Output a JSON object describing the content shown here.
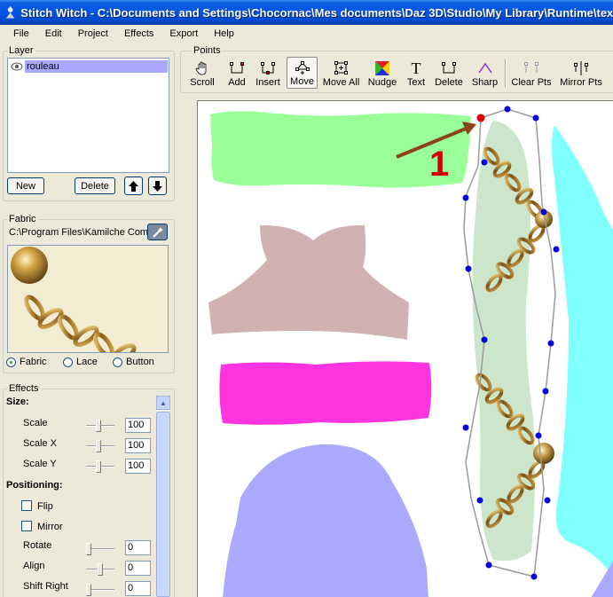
{
  "window": {
    "title": "Stitch Witch - C:\\Documents and Settings\\Chocornac\\Mes documents\\Daz 3D\\Studio\\My Library\\Runtime\\textures"
  },
  "menu": [
    "File",
    "Edit",
    "Project",
    "Effects",
    "Export",
    "Help"
  ],
  "layer_panel": {
    "title": "Layer",
    "layers": [
      {
        "name": "rouleau",
        "visible": true,
        "selected": true
      }
    ],
    "new_label": "New",
    "delete_label": "Delete"
  },
  "fabric_panel": {
    "title": "Fabric",
    "path": "C:\\Program Files\\Kamilche Company",
    "options": [
      "Fabric",
      "Lace",
      "Button"
    ],
    "selected": "Fabric"
  },
  "effects_panel": {
    "title": "Effects",
    "size_heading": "Size:",
    "scale_label": "Scale",
    "scale_value": "100",
    "scalex_label": "Scale X",
    "scalex_value": "100",
    "scaley_label": "Scale Y",
    "scaley_value": "100",
    "positioning_heading": "Positioning:",
    "flip_label": "Flip",
    "flip_checked": false,
    "mirror_label": "Mirror",
    "mirror_checked": false,
    "rotate_label": "Rotate",
    "rotate_value": "0",
    "align_label": "Align",
    "align_value": "0",
    "shiftright_label": "Shift Right",
    "shiftright_value": "0"
  },
  "points_toolbar": {
    "title": "Points",
    "tools": [
      {
        "label": "Scroll",
        "icon": "hand-icon"
      },
      {
        "label": "Add",
        "icon": "add-point-icon"
      },
      {
        "label": "Insert",
        "icon": "insert-point-icon"
      },
      {
        "label": "Move",
        "icon": "move-icon",
        "active": true
      },
      {
        "label": "Move All",
        "icon": "move-all-icon"
      },
      {
        "label": "Nudge",
        "icon": "nudge-icon"
      },
      {
        "label": "Text",
        "icon": "text-icon"
      },
      {
        "label": "Delete",
        "icon": "delete-point-icon"
      },
      {
        "label": "Sharp",
        "icon": "sharp-icon"
      },
      {
        "label": "Clear Pts",
        "icon": "clear-points-icon"
      },
      {
        "label": "Mirror Pts",
        "icon": "mirror-points-icon"
      }
    ]
  },
  "annotation": {
    "number": "1"
  },
  "colors": {
    "selection": "#a8a8ff",
    "point": "#0000dd",
    "selected_point": "#e00000",
    "arrow": "#8b4513",
    "annotation": "#d10000",
    "piece_green": "#99ff99",
    "piece_rose": "#d0b3b0",
    "piece_magenta": "#ff33e0",
    "piece_lavender": "#aaaaff",
    "piece_cyan": "#80ffff",
    "piece_sage": "#cce6cc"
  }
}
